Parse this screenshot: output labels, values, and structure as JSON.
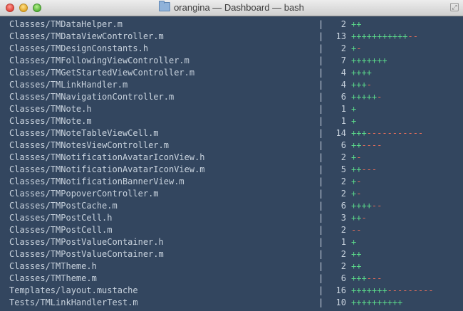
{
  "window": {
    "title": "orangina — Dashboard — bash",
    "folder_icon": "folder-icon"
  },
  "colors": {
    "background": "#33465f",
    "text": "#c9d3de",
    "additions": "#5bd88a",
    "deletions": "#e36d5a"
  },
  "diffstat": {
    "separator": "|",
    "rows": [
      {
        "path": "Classes/TMDataHelper.m",
        "count": "2",
        "plus": "++",
        "minus": ""
      },
      {
        "path": "Classes/TMDataViewController.m",
        "count": "13",
        "plus": "+++++++++++",
        "minus": "--"
      },
      {
        "path": "Classes/TMDesignConstants.h",
        "count": "2",
        "plus": "+",
        "minus": "-"
      },
      {
        "path": "Classes/TMFollowingViewController.m",
        "count": "7",
        "plus": "+++++++",
        "minus": ""
      },
      {
        "path": "Classes/TMGetStartedViewController.m",
        "count": "4",
        "plus": "++++",
        "minus": ""
      },
      {
        "path": "Classes/TMLinkHandler.m",
        "count": "4",
        "plus": "+++",
        "minus": "-"
      },
      {
        "path": "Classes/TMNavigationController.m",
        "count": "6",
        "plus": "+++++",
        "minus": "-"
      },
      {
        "path": "Classes/TMNote.h",
        "count": "1",
        "plus": "+",
        "minus": ""
      },
      {
        "path": "Classes/TMNote.m",
        "count": "1",
        "plus": "+",
        "minus": ""
      },
      {
        "path": "Classes/TMNoteTableViewCell.m",
        "count": "14",
        "plus": "+++",
        "minus": "-----------"
      },
      {
        "path": "Classes/TMNotesViewController.m",
        "count": "6",
        "plus": "++",
        "minus": "----"
      },
      {
        "path": "Classes/TMNotificationAvatarIconView.h",
        "count": "2",
        "plus": "+",
        "minus": "-"
      },
      {
        "path": "Classes/TMNotificationAvatarIconView.m",
        "count": "5",
        "plus": "++",
        "minus": "---"
      },
      {
        "path": "Classes/TMNotificationBannerView.m",
        "count": "2",
        "plus": "+",
        "minus": "-"
      },
      {
        "path": "Classes/TMPopoverController.m",
        "count": "2",
        "plus": "+",
        "minus": "-"
      },
      {
        "path": "Classes/TMPostCache.m",
        "count": "6",
        "plus": "++++",
        "minus": "--"
      },
      {
        "path": "Classes/TMPostCell.h",
        "count": "3",
        "plus": "++",
        "minus": "-"
      },
      {
        "path": "Classes/TMPostCell.m",
        "count": "2",
        "plus": "",
        "minus": "--"
      },
      {
        "path": "Classes/TMPostValueContainer.h",
        "count": "1",
        "plus": "+",
        "minus": ""
      },
      {
        "path": "Classes/TMPostValueContainer.m",
        "count": "2",
        "plus": "++",
        "minus": ""
      },
      {
        "path": "Classes/TMTheme.h",
        "count": "2",
        "plus": "++",
        "minus": ""
      },
      {
        "path": "Classes/TMTheme.m",
        "count": "6",
        "plus": "+++",
        "minus": "---"
      },
      {
        "path": "Templates/layout.mustache",
        "count": "16",
        "plus": "+++++++",
        "minus": "---------"
      },
      {
        "path": "Tests/TMLinkHandlerTest.m",
        "count": "10",
        "plus": "++++++++++",
        "minus": ""
      }
    ]
  }
}
